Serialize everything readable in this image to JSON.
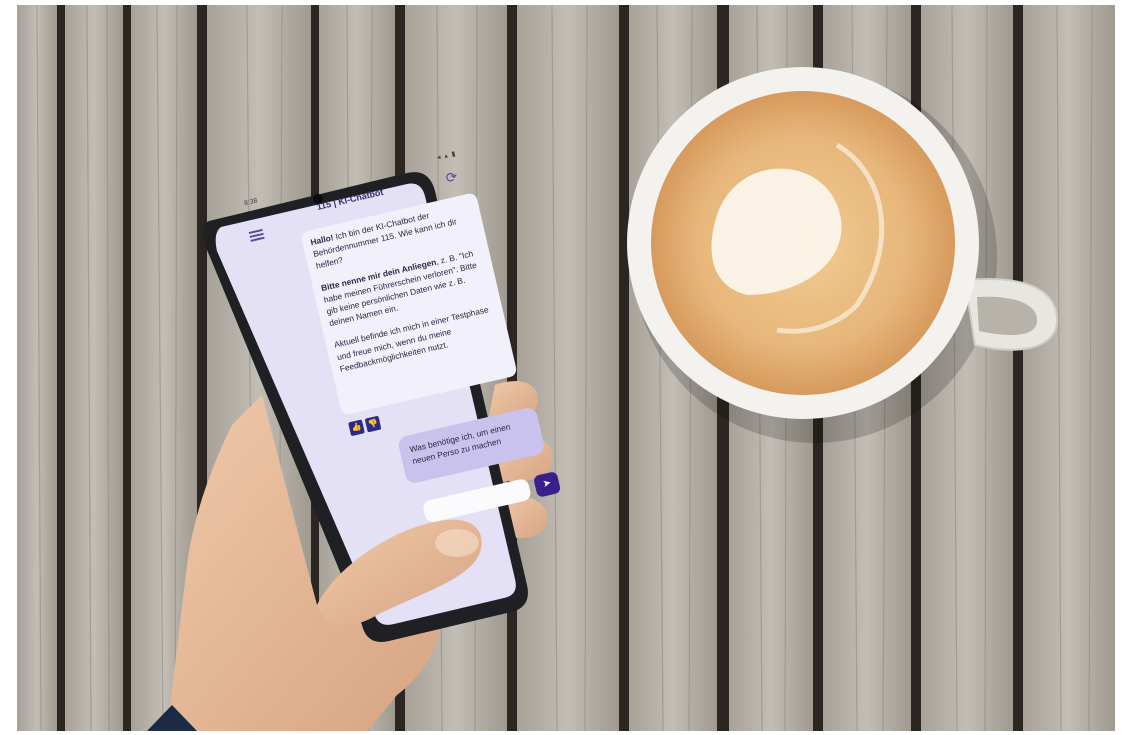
{
  "phone": {
    "status_time": "8:38",
    "status_icons": "◂ ▴ ▮",
    "app_title": "115 | KI-Chatbot",
    "menu_icon": "hamburger-menu-icon",
    "reload_icon": "reload-icon",
    "bot_message": {
      "greeting_bold": "Hallo!",
      "greeting_text": " Ich bin der KI-Chatbot der Behördennummer 115. Wie kann ich dir helfen?",
      "request_bold": "Bitte nenne mir dein Anliegen",
      "request_text": ", z. B. \"Ich habe meinen Führerschein verloren\". Bitte gib keine persönlichen Daten wie z. B. deinen Namen ein.",
      "test_phase": "Aktuell befinde ich mich in einer Testphase und freue mich, wenn du meine Feedbackmöglichkeiten nutzt."
    },
    "feedback": {
      "thumbs_up": "👍",
      "thumbs_down": "👎"
    },
    "user_message": "Was benötige ich, um einen neuen Perso zu machen",
    "send_icon": "➤"
  },
  "colors": {
    "wood_light": "#b7b2aa",
    "wood_mid": "#9d988f",
    "wood_gap": "#2b2621",
    "coffee_foam": "#e8b87a",
    "cup_white": "#f3f2ef",
    "phone_body": "#1f2024",
    "screen_bg": "#e4e0f5",
    "accent_purple": "#3a1f8c"
  }
}
